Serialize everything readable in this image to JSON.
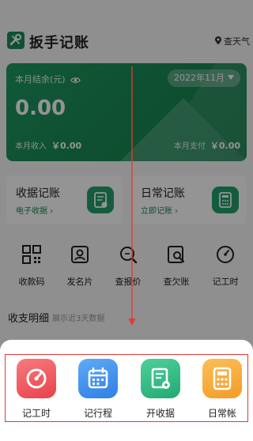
{
  "header": {
    "title": "扳手记账",
    "weather": "查天气"
  },
  "card": {
    "balance_label": "本月结余(元)",
    "month": "2022年11月",
    "balance": "0.00",
    "income_label": "本月收入",
    "income_value": "￥0.00",
    "expense_label": "本月支付",
    "expense_value": "￥0.00"
  },
  "quick": [
    {
      "title": "收据记账",
      "sub": "电子收据 ›"
    },
    {
      "title": "日常记账",
      "sub": "立即记账 ›"
    }
  ],
  "tools": [
    {
      "label": "收款码",
      "icon": "qr-code-icon"
    },
    {
      "label": "发名片",
      "icon": "business-card-icon"
    },
    {
      "label": "查报价",
      "icon": "price-search-icon"
    },
    {
      "label": "查欠账",
      "icon": "debt-search-icon"
    },
    {
      "label": "记工时",
      "icon": "clock-icon"
    }
  ],
  "section": {
    "title": "收支明细",
    "sub": "展示近3天数据"
  },
  "sheet": {
    "actions": [
      {
        "label": "记工时",
        "icon": "work-hours-icon",
        "color": "#f0565c"
      },
      {
        "label": "记行程",
        "icon": "calendar-icon",
        "color": "#3a8ff0"
      },
      {
        "label": "开收据",
        "icon": "receipt-icon",
        "color": "#2dbb82"
      },
      {
        "label": "日常帐",
        "icon": "calculator-icon",
        "color": "#f8a93a"
      }
    ]
  },
  "colors": {
    "accent": "#1a8a56",
    "annotation": "#e53935"
  }
}
